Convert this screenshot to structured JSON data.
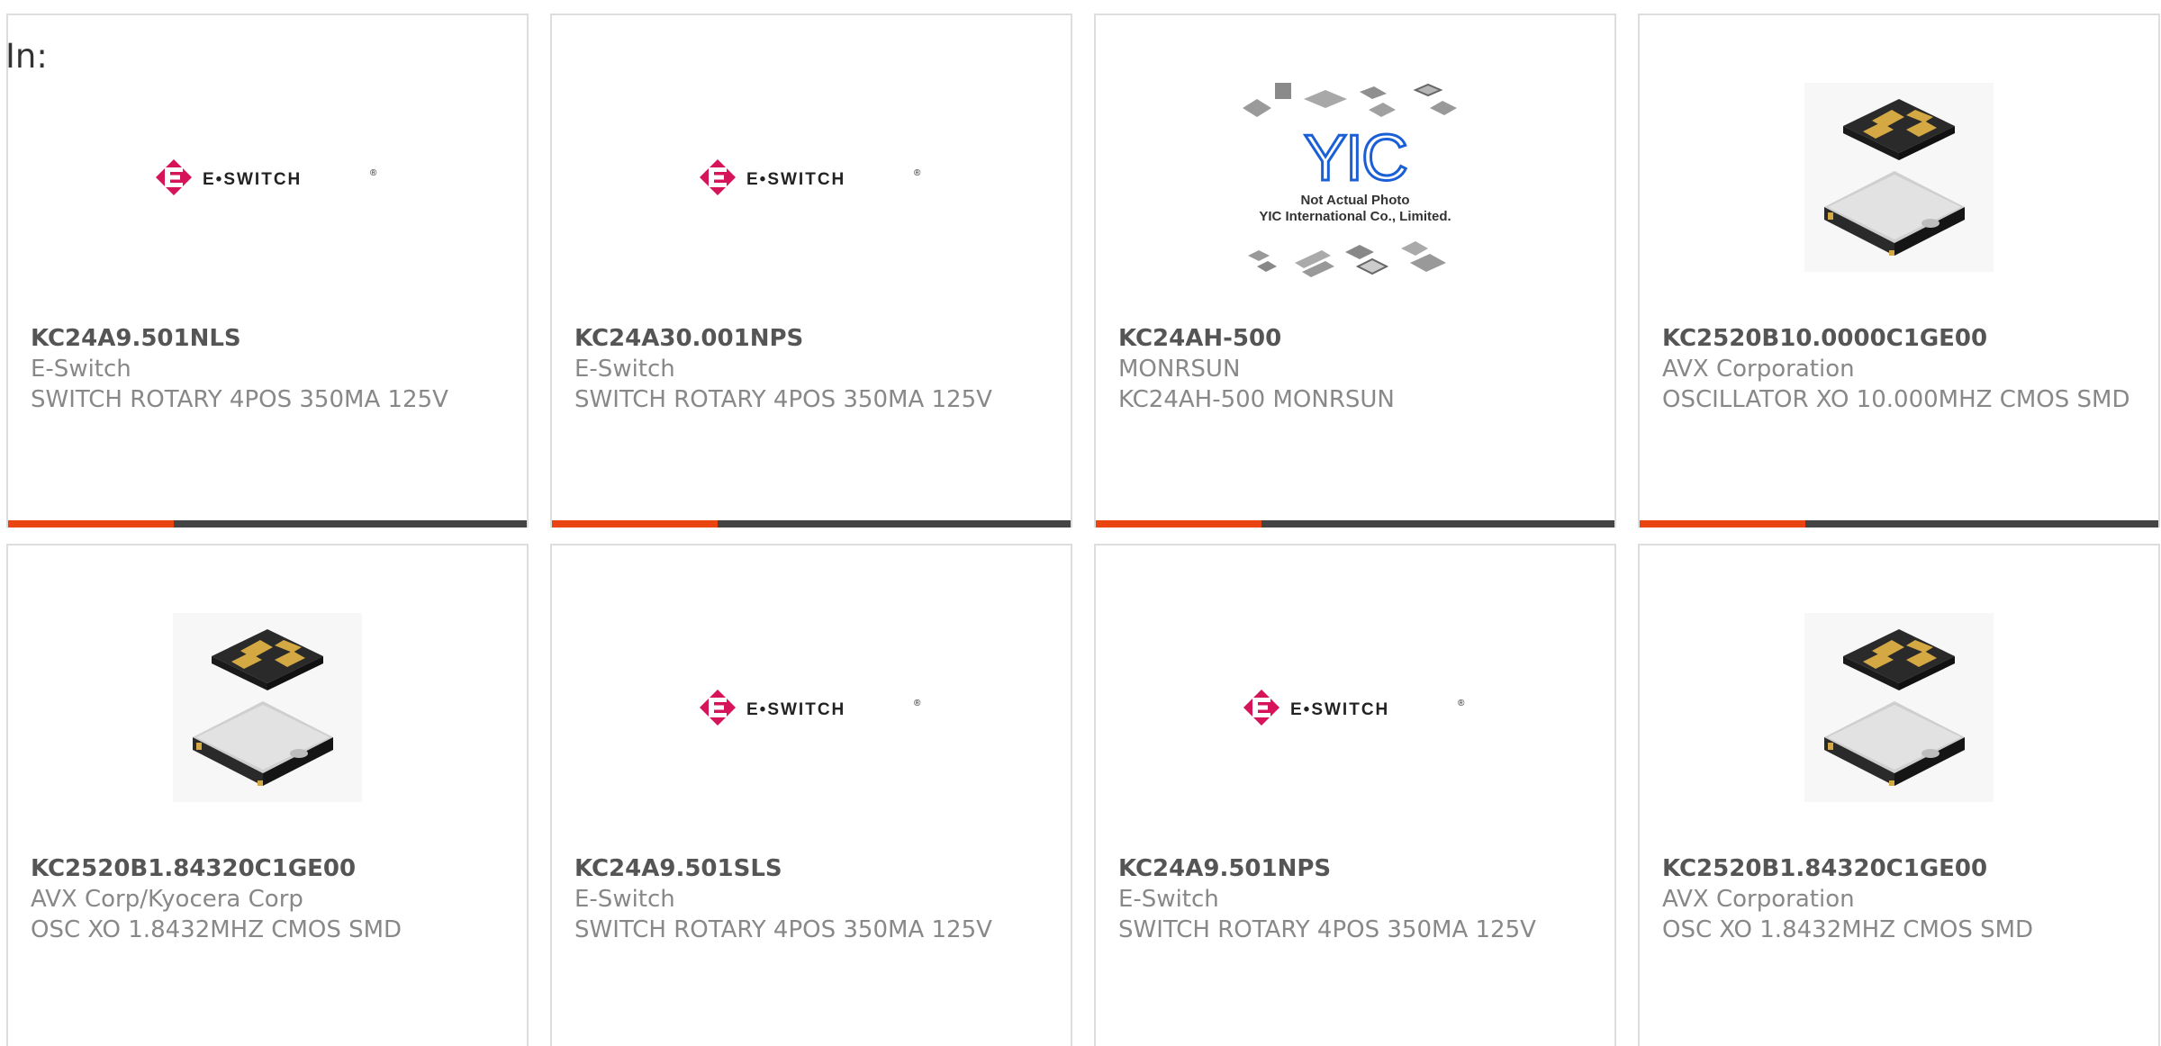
{
  "header": {
    "in_label": "In:"
  },
  "colors": {
    "accent": "#e84510",
    "bar_track": "#444444",
    "card_border": "#dddddd",
    "eswitch_brand": "#d6145a",
    "yic_blue": "#1b5fd6"
  },
  "cards": [
    {
      "part": "KC24A9.501NLS",
      "manufacturer": "E-Switch",
      "description": "SWITCH ROTARY 4POS 350MA 125V",
      "image": "eswitch-logo",
      "bar_fill": 0.32
    },
    {
      "part": "KC24A30.001NPS",
      "manufacturer": "E-Switch",
      "description": "SWITCH ROTARY 4POS 350MA 125V",
      "image": "eswitch-logo",
      "bar_fill": 0.32
    },
    {
      "part": "KC24AH-500",
      "manufacturer": "MONRSUN",
      "description": "KC24AH-500 MONRSUN",
      "image": "yic-placeholder",
      "image_text": {
        "line1": "Not Actual Photo",
        "line2": "YIC International Co., Limited."
      },
      "bar_fill": 0.32
    },
    {
      "part": "KC2520B10.0000C1GE00",
      "manufacturer": "AVX Corporation",
      "description": "OSCILLATOR XO 10.000MHZ CMOS SMD",
      "image": "crystal-oscillator",
      "bar_fill": 0.32
    },
    {
      "part": "KC2520B1.84320C1GE00",
      "manufacturer": "AVX Corp/Kyocera Corp",
      "description": "OSC XO 1.8432MHZ CMOS SMD",
      "image": "crystal-oscillator"
    },
    {
      "part": "KC24A9.501SLS",
      "manufacturer": "E-Switch",
      "description": "SWITCH ROTARY 4POS 350MA 125V",
      "image": "eswitch-logo"
    },
    {
      "part": "KC24A9.501NPS",
      "manufacturer": "E-Switch",
      "description": "SWITCH ROTARY 4POS 350MA 125V",
      "image": "eswitch-logo"
    },
    {
      "part": "KC2520B1.84320C1GE00",
      "manufacturer": "AVX Corporation",
      "description": "OSC XO 1.8432MHZ CMOS SMD",
      "image": "crystal-oscillator"
    }
  ],
  "logo": {
    "eswitch_text": "E•SWITCH",
    "eswitch_reg": "®",
    "yic_text": "YIC"
  }
}
